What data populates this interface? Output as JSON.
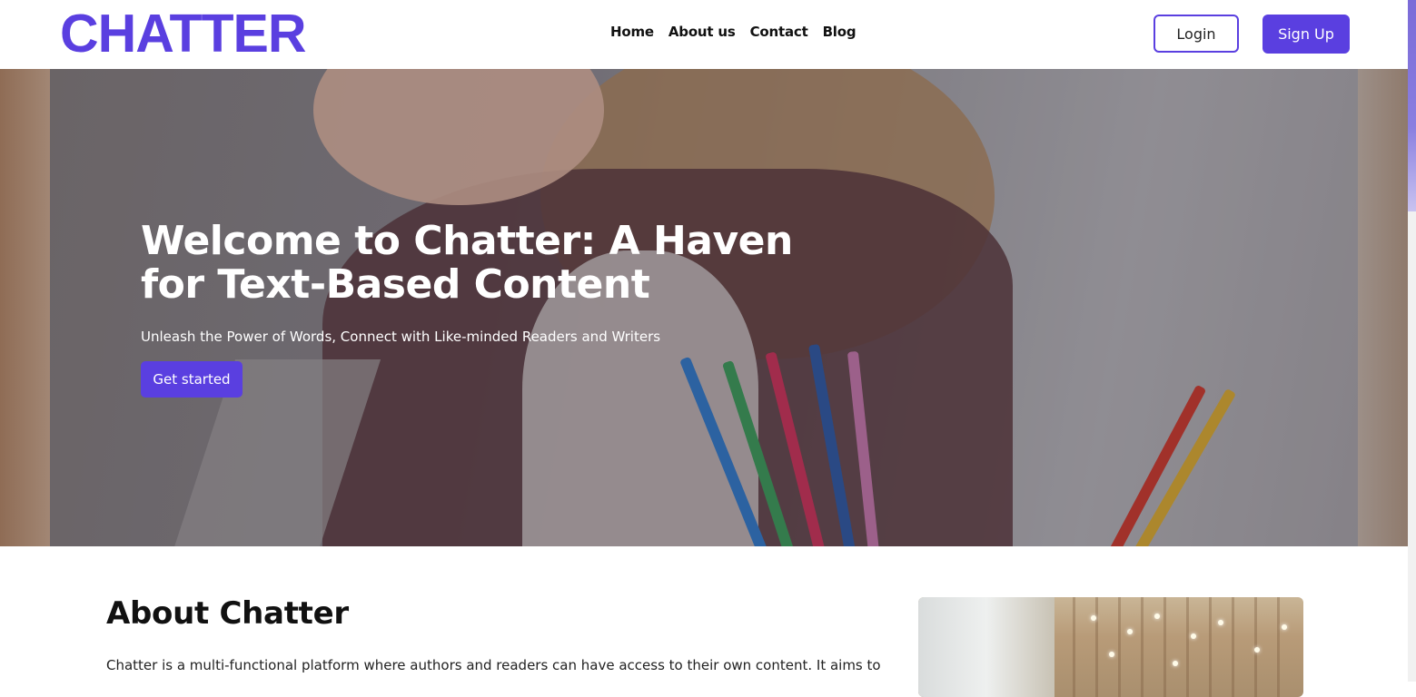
{
  "header": {
    "logo": "CHATTER",
    "nav": [
      "Home",
      "About us",
      "Contact",
      "Blog"
    ],
    "login_label": "Login",
    "signup_label": "Sign Up"
  },
  "hero": {
    "title": "Welcome to Chatter: A Haven for Text-Based Content",
    "subtitle": "Unleash the Power of Words, Connect with Like-minded Readers and Writers",
    "cta_label": "Get started"
  },
  "about": {
    "title": "About Chatter",
    "text": "Chatter is a multi-functional platform where authors and readers can have access to their own content. It aims to"
  },
  "colors": {
    "accent": "#5a3fe0"
  }
}
